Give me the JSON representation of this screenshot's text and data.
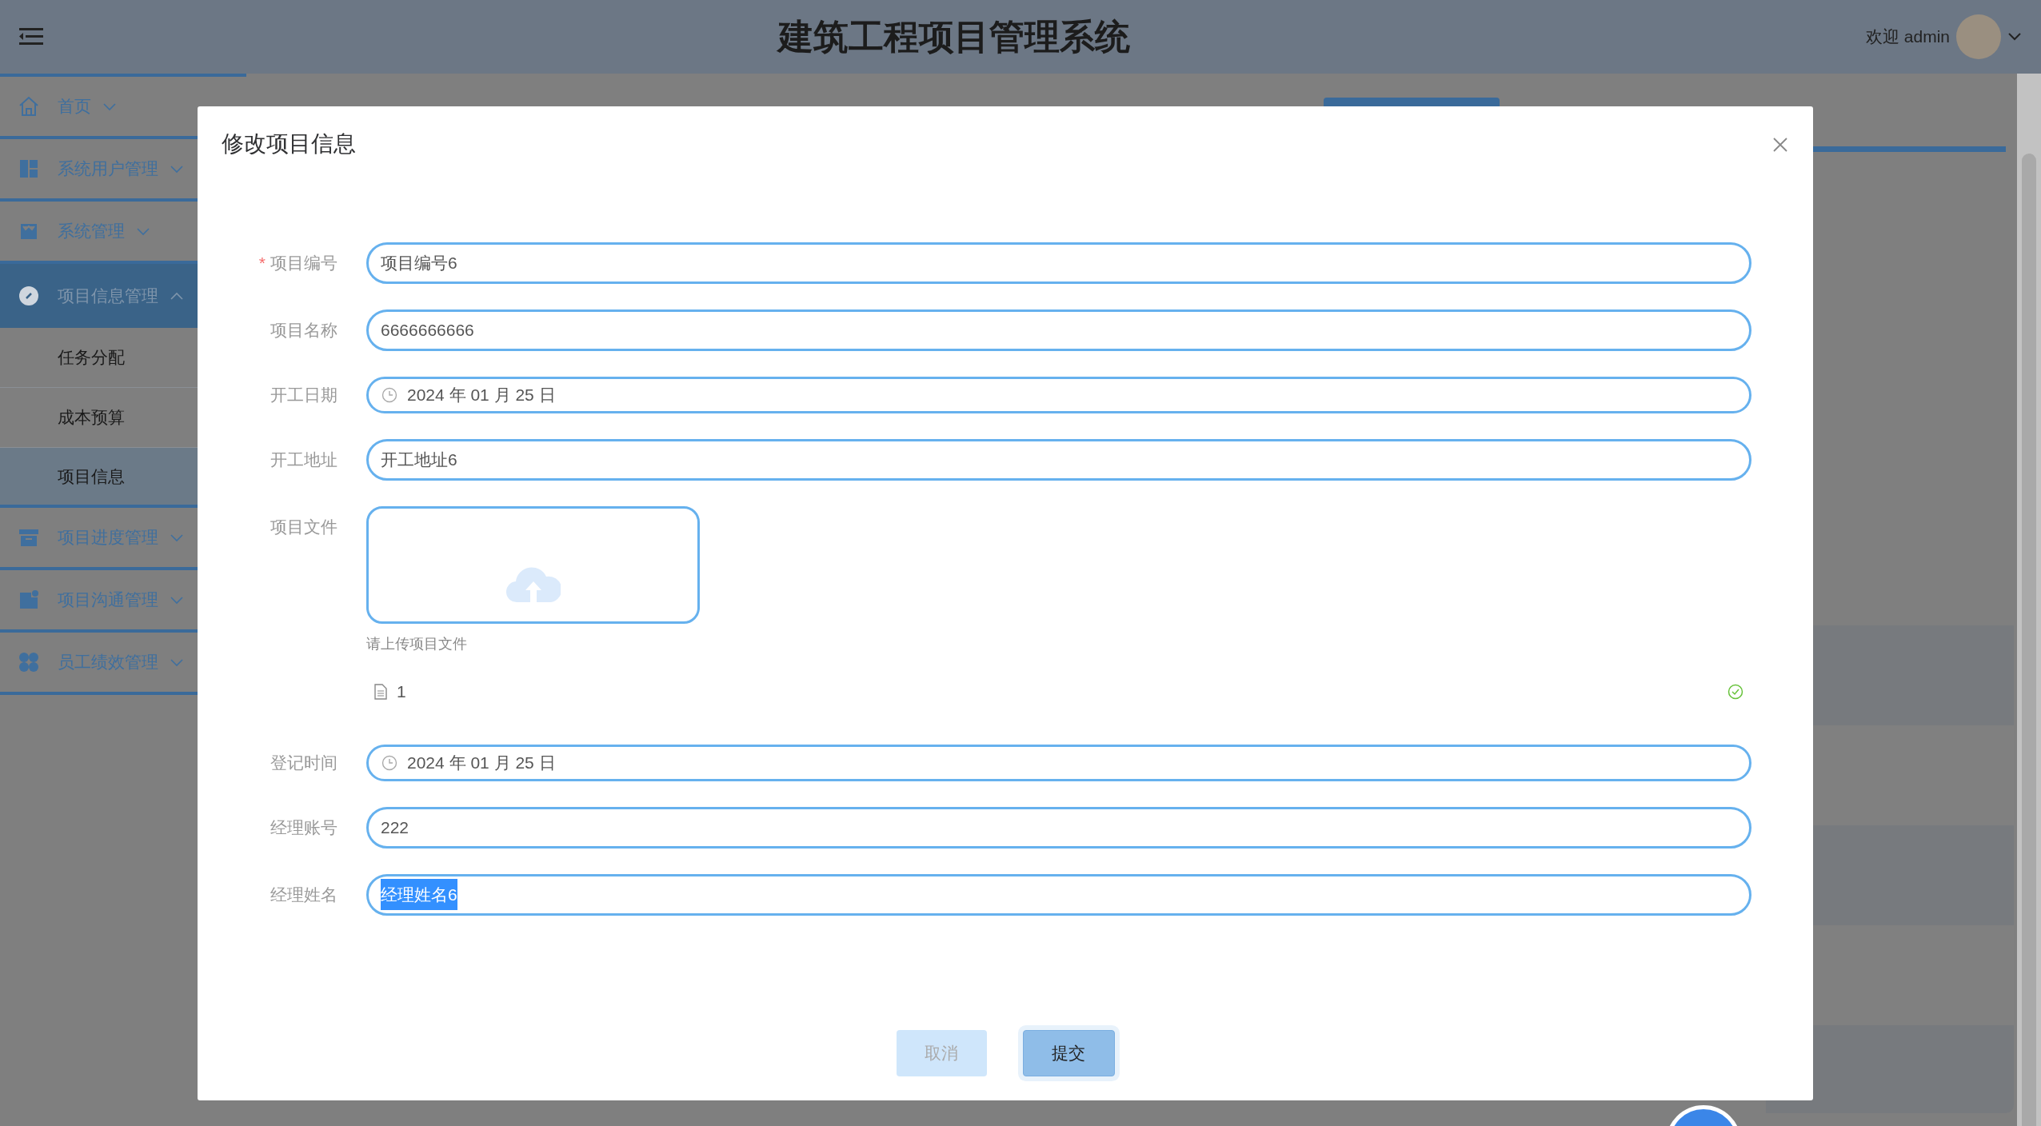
{
  "header": {
    "title": "建筑工程项目管理系统",
    "welcome": "欢迎 admin"
  },
  "sidebar": {
    "items": [
      {
        "label": "首页",
        "expanded": false
      },
      {
        "label": "系统用户管理",
        "expanded": false
      },
      {
        "label": "系统管理",
        "expanded": false
      },
      {
        "label": "项目信息管理",
        "expanded": true,
        "children": [
          {
            "label": "任务分配",
            "selected": false
          },
          {
            "label": "成本预算",
            "selected": false
          },
          {
            "label": "项目信息",
            "selected": true
          }
        ]
      },
      {
        "label": "项目进度管理",
        "expanded": false
      },
      {
        "label": "项目沟通管理",
        "expanded": false
      },
      {
        "label": "员工绩效管理",
        "expanded": false
      }
    ]
  },
  "dialog": {
    "title": "修改项目信息",
    "fields": [
      {
        "kind": "text",
        "label": "项目编号",
        "required_mark": "*",
        "value": "项目编号6"
      },
      {
        "kind": "text",
        "label": "项目名称",
        "value": "6666666666"
      },
      {
        "kind": "date",
        "label": "开工日期",
        "value": "2024 年 01 月 25 日"
      },
      {
        "kind": "text",
        "label": "开工地址",
        "value": "开工地址6"
      },
      {
        "kind": "upload",
        "label": "项目文件",
        "hint": "请上传项目文件",
        "files": [
          {
            "name": "1",
            "done": true
          }
        ]
      },
      {
        "kind": "date",
        "label": "登记时间",
        "value": "2024 年 01 月 25 日"
      },
      {
        "kind": "text",
        "label": "经理账号",
        "value": "222"
      },
      {
        "kind": "text",
        "label": "经理姓名",
        "value": "经理姓名6",
        "text_selected": true
      }
    ],
    "buttons": [
      {
        "label": "取消",
        "disabled": true,
        "focused": false
      },
      {
        "label": "提交",
        "disabled": false,
        "focused": true
      }
    ]
  }
}
